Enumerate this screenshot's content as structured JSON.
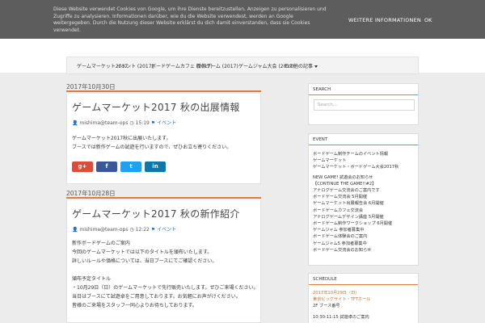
{
  "cookie_bar": {
    "text": "Diese Website verwendet Cookies von Google, um ihre Dienste bereitzustellen, Anzeigen zu personalisieren und Zugriffe zu analysieren. Informationen darüber, wie du die Website verwendest, werden an Google weitergegeben. Durch die Nutzung dieser Website erklärst du dich damit einverstanden, dass sie Cookies verwendet.",
    "more_label": "WEITERE INFORMATIONEN",
    "ok_label": "OK"
  },
  "nav": {
    "items": [
      {
        "label": "ゲームマーケット2017"
      },
      {
        "label": "イベント (2017)"
      },
      {
        "label": "ボードゲームカフェ (2017)"
      },
      {
        "label": "新作ゲーム (2017)"
      },
      {
        "label": "ゲームジャム大会 (2017)"
      },
      {
        "label": "その他の記事"
      }
    ]
  },
  "posts": [
    {
      "date": "2017年10月30日",
      "title": "ゲームマーケット2017 秋の出展情報",
      "author": "mishima@team-ops",
      "time": "15:19",
      "label": "イベント",
      "body": [
        "ゲームマーケット2017秋に出展いたします。",
        "ブースでは新作ゲームの試遊を行いますので、ぜひお立ち寄りください。"
      ],
      "share": [
        "g+",
        "f",
        "t",
        "in"
      ]
    },
    {
      "date": "2017年10月28日",
      "title": "ゲームマーケット2017 秋の新作紹介",
      "author": "mishima@team-ops",
      "time": "12:22",
      "label": "イベント",
      "body": [
        "新作ボードゲームのご案内",
        "今回のゲームマーケットでは以下のタイトルを頒布いたします。",
        "詳しいルールや価格については、当日ブースにてご確認ください。",
        "",
        "頒布予定タイトル",
        "・10月29日（日）のゲームマーケットで先行販売いたします。ぜひご来場ください。",
        "当日はブースにて試遊卓をご用意しております。お気軽にお声がけください。",
        "皆様のご来場をスタッフ一同心よりお待ちしております。"
      ]
    }
  ],
  "sidebar": {
    "search": {
      "title": "SEARCH",
      "placeholder": "Search..."
    },
    "event": {
      "title": "EVENT",
      "lines": [
        "ボードゲーム制作チームのイベント情報",
        "ゲームマーケット",
        "ゲームマーケット・ボードゲーム大会2017秋",
        "",
        "NEW GAME! 試遊会のお知らせ",
        "【CONTINUE THE GAME!!#2】",
        "アナログゲーム交流会のご案内です",
        "ボードゲーム交流会 5月開催",
        "ゲームマーケット出展報告会 6月開催",
        "ボードゲームカフェ交流会",
        "アナログゲームデザイン講座 5月開催",
        "ボードゲーム制作ワークショップ 6月開催",
        "ゲームジャム 参加者募集中",
        "ボードゲーム体験会のご案内",
        "ゲームジャム5 参加者募集中",
        "ボードゲーム交流会のお知らせ"
      ]
    },
    "schedule": {
      "title": "SCHEDULE",
      "lines": [
        {
          "text": "2017年10月29日（日）",
          "accent": true
        },
        {
          "text": "東京ビッグサイト・TFTホール",
          "accent": true
        },
        {
          "text": "2F ブース番号",
          "accent": false
        },
        {
          "text": "",
          "accent": false
        },
        {
          "text": "10:30-11:15 試遊卓のご案内",
          "accent": false
        }
      ]
    }
  },
  "colors": {
    "cookie_bg": "#5d5d5d",
    "accent_orange": "#e07b39",
    "label_blue": "#1f6fb2",
    "gplus": "#dd4b39",
    "facebook": "#3b5998",
    "twitter": "#1da1f2",
    "linkedin": "#0e76a8"
  }
}
